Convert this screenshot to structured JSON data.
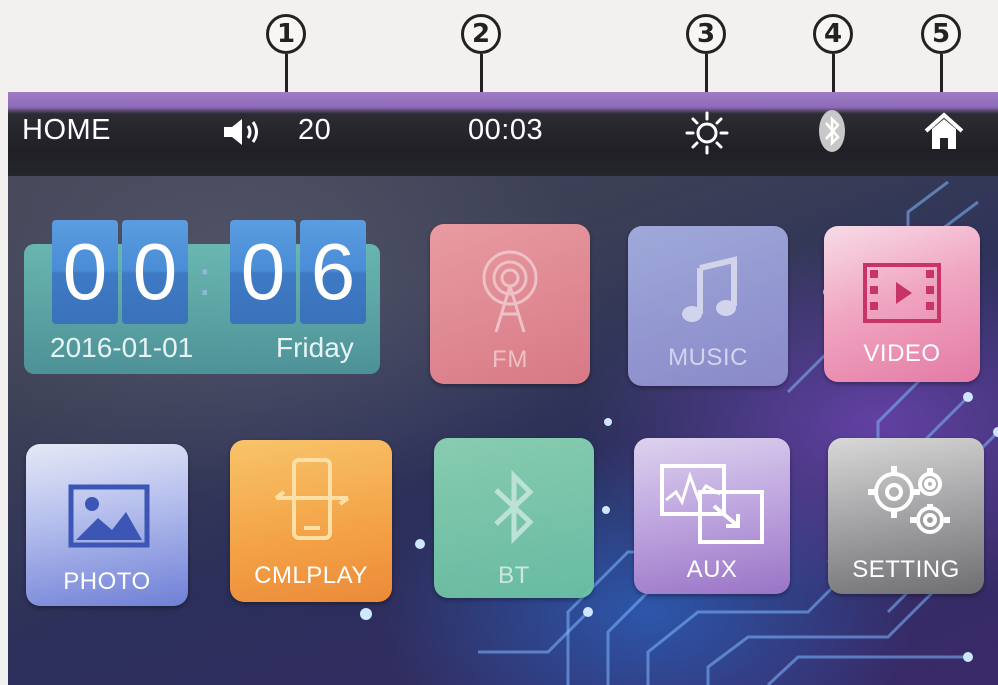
{
  "callouts": [
    "1",
    "2",
    "3",
    "4",
    "5"
  ],
  "status_bar": {
    "home_label": "HOME",
    "volume_icon": "speaker-icon",
    "volume_value": "20",
    "time": "00:03",
    "brightness_icon": "sun-icon",
    "bluetooth_icon": "bluetooth-icon",
    "home_icon": "home-icon"
  },
  "clock_widget": {
    "hour_tens": "0",
    "hour_ones": "0",
    "minute_tens": "0",
    "minute_ones": "6",
    "separator": ":",
    "date": "2016-01-01",
    "weekday": "Friday"
  },
  "apps": [
    {
      "label": "FM",
      "icon": "radio-tower-icon",
      "color": "#e98a92"
    },
    {
      "label": "MUSIC",
      "icon": "music-note-icon",
      "color": "#9a9ed8"
    },
    {
      "label": "VIDEO",
      "icon": "film-play-icon",
      "color": "#ef8fb4"
    },
    {
      "label": "PHOTO",
      "icon": "picture-icon",
      "color": "#7f8fd8"
    },
    {
      "label": "CMLPLAY",
      "icon": "phone-link-icon",
      "color": "#f0a24a"
    },
    {
      "label": "BT",
      "icon": "bluetooth-icon",
      "color": "#6fc8a8"
    },
    {
      "label": "AUX",
      "icon": "aux-input-icon",
      "color": "#a27cc8"
    },
    {
      "label": "SETTING",
      "icon": "gears-icon",
      "color": "#8a8a8c"
    }
  ]
}
